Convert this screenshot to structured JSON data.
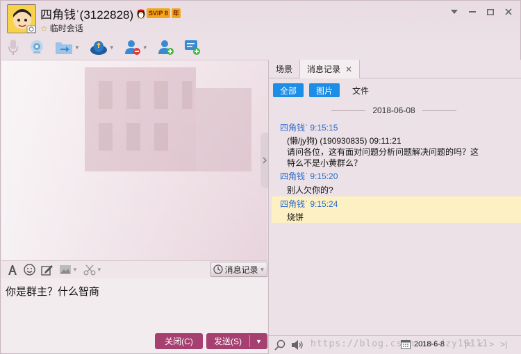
{
  "title": {
    "name": "四角钱ˈ(3122828)",
    "vip_label": "SVIP 8",
    "year_label": "年",
    "session_label": "临时会话"
  },
  "window_controls": [
    "▼",
    "—",
    "☐",
    "✕"
  ],
  "toolbar": {
    "icons": [
      "microphone-icon",
      "video-icon",
      "file-transfer-icon",
      "remote-assist-icon",
      "remove-contact-icon",
      "add-contact-icon",
      "send-message-icon"
    ]
  },
  "input_toolbar": {
    "icons": [
      "font-icon",
      "emoji-icon",
      "edit-icon",
      "image-icon",
      "scissors-icon"
    ],
    "history_label": "消息记录"
  },
  "input": {
    "text": "你是群主？什么智商"
  },
  "buttons": {
    "close_label": "关闭(C)",
    "send_label": "发送(S)"
  },
  "right_panel": {
    "tabs": [
      {
        "label": "场景"
      },
      {
        "label": "消息记录"
      }
    ],
    "filters": [
      {
        "label": "全部"
      },
      {
        "label": "图片"
      },
      {
        "label": "文件"
      }
    ],
    "date_divider": "2018-06-08",
    "messages": [
      {
        "sender": "四角钱ˈ 9:15:15",
        "lines": [
          "(懒/jy狗) (190930835)  09:11:21",
          "请问各位，这有面对问题分析问题解决问题的吗？这",
          "特么不是小黄群么？"
        ]
      },
      {
        "sender": "四角钱ˈ 9:15:20",
        "lines": [
          "别人欠你的?"
        ]
      },
      {
        "sender": "四角钱ˈ 9:15:24",
        "lines": [
          "烧饼"
        ]
      }
    ],
    "bottom_date": "2018-6-8",
    "watermark": "https://blog.csdn.net/zy19111"
  }
}
